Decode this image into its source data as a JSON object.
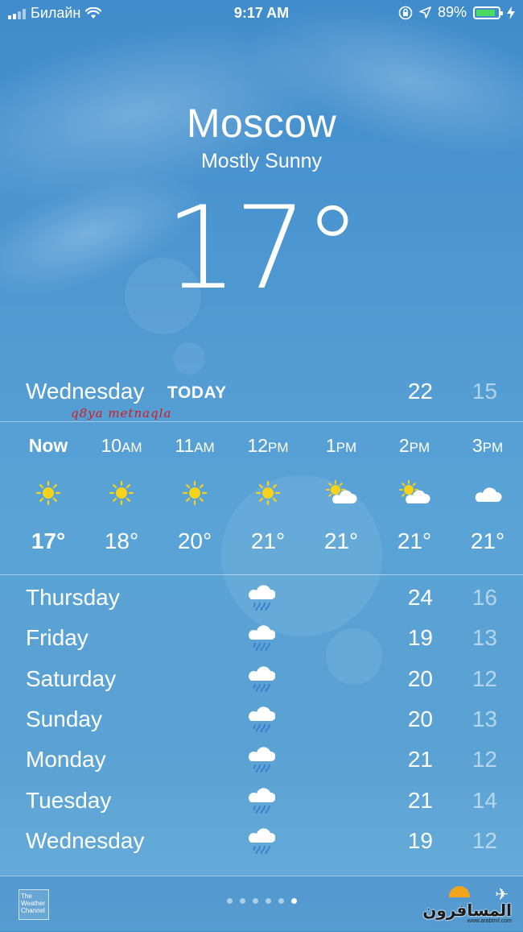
{
  "status_bar": {
    "carrier": "Билайн",
    "time": "9:17 AM",
    "battery_percent": "89%",
    "battery_level": 0.89,
    "battery_color": "#4cd964"
  },
  "location": {
    "city": "Moscow",
    "condition": "Mostly Sunny",
    "temperature": "17°"
  },
  "today": {
    "day": "Wednesday",
    "tag": "TODAY",
    "high": "22",
    "low": "15"
  },
  "watermark": "q8ya metnaqla",
  "hourly": [
    {
      "time": "Now",
      "suffix": "",
      "icon": "sun-icon",
      "temp": "17°",
      "bold": true
    },
    {
      "time": "10",
      "suffix": "AM",
      "icon": "sun-icon",
      "temp": "18°",
      "bold": false
    },
    {
      "time": "11",
      "suffix": "AM",
      "icon": "sun-icon",
      "temp": "20°",
      "bold": false
    },
    {
      "time": "12",
      "suffix": "PM",
      "icon": "sun-icon",
      "temp": "21°",
      "bold": false
    },
    {
      "time": "1",
      "suffix": "PM",
      "icon": "partly-cloudy-icon",
      "temp": "21°",
      "bold": false
    },
    {
      "time": "2",
      "suffix": "PM",
      "icon": "partly-cloudy-icon",
      "temp": "21°",
      "bold": false
    },
    {
      "time": "3",
      "suffix": "PM",
      "icon": "cloud-icon",
      "temp": "21°",
      "bold": false
    }
  ],
  "daily": [
    {
      "day": "Thursday",
      "icon": "rain-icon",
      "high": "24",
      "low": "16"
    },
    {
      "day": "Friday",
      "icon": "rain-icon",
      "high": "19",
      "low": "13"
    },
    {
      "day": "Saturday",
      "icon": "rain-icon",
      "high": "20",
      "low": "12"
    },
    {
      "day": "Sunday",
      "icon": "rain-icon",
      "high": "20",
      "low": "13"
    },
    {
      "day": "Monday",
      "icon": "rain-icon",
      "high": "21",
      "low": "12"
    },
    {
      "day": "Tuesday",
      "icon": "rain-icon",
      "high": "21",
      "low": "14"
    },
    {
      "day": "Wednesday",
      "icon": "rain-icon",
      "high": "19",
      "low": "12"
    }
  ],
  "bottom_bar": {
    "weather_channel_label": "The Weather Channel",
    "page_count": 6,
    "active_page": 6,
    "logo_text": "المسافرون",
    "logo_small_text": "العرب",
    "logo_url_text": "www.arabtrvl.com"
  }
}
